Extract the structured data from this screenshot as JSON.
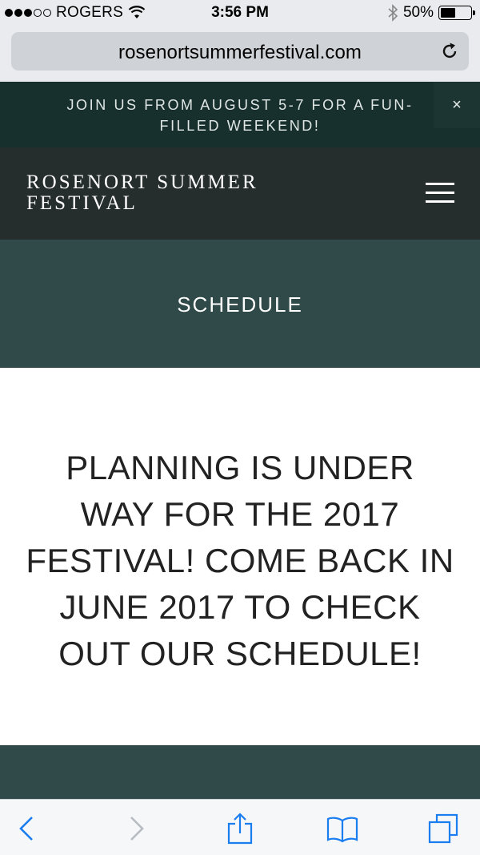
{
  "status_bar": {
    "carrier": "ROGERS",
    "time": "3:56 PM",
    "battery_label": "50%",
    "battery_level": 0.5,
    "signal_strength": 3,
    "signal_max": 5
  },
  "browser": {
    "url": "rosenortsummerfestival.com"
  },
  "announcement": {
    "text": "JOIN US FROM AUGUST 5-7 FOR A FUN-FILLED WEEKEND!",
    "close_label": "×"
  },
  "header": {
    "site_title": "ROSENORT SUMMER FESTIVAL"
  },
  "banner": {
    "title": "SCHEDULE"
  },
  "main": {
    "message": "PLANNING IS UNDER WAY FOR THE 2017 FESTIVAL! COME BACK IN JUNE 2017 TO CHECK OUT OUR SCHEDULE!"
  },
  "toolbar": {
    "icons": [
      "back-icon",
      "forward-icon",
      "share-icon",
      "bookmarks-icon",
      "tabs-icon"
    ],
    "accent_color": "#1a7df0",
    "disabled_color": "#b7bcc2"
  },
  "colors": {
    "announcement_bg": "#17302e",
    "header_bg": "#252e2d",
    "banner_bg": "#2f4a48"
  }
}
